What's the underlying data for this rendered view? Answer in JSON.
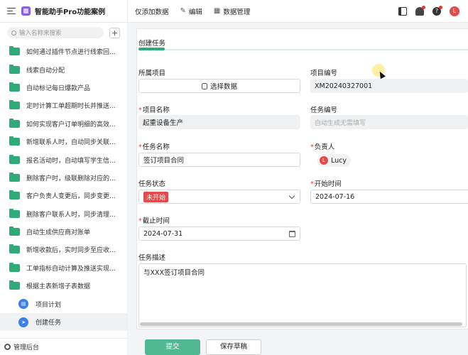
{
  "app": {
    "title": "智能助手Pro功能案例",
    "user_avatar": "L"
  },
  "toolbar": {
    "add_only": "仅添加数据",
    "edit": "编辑",
    "data_manage": "数据管理"
  },
  "sidebar": {
    "search_placeholder": "输入名称来搜索",
    "add_symbol": "+",
    "items": [
      {
        "label": "如何通过插件节点进行线索回..."
      },
      {
        "label": "线索自动分配"
      },
      {
        "label": "自动标记每日爆款产品"
      },
      {
        "label": "定时计算工单超期时长并推送..."
      },
      {
        "label": "如何实现客户订单明细的高效..."
      },
      {
        "label": "新增联系人时，自动同步关联..."
      },
      {
        "label": "报名活动时，自动填写学生信..."
      },
      {
        "label": "删除客户时，级联删除对应的..."
      },
      {
        "label": "客户负责人变更后，同步变更..."
      },
      {
        "label": "删除客户联系人时，同步清理..."
      },
      {
        "label": "自动生成供应商对账单"
      },
      {
        "label": "新增收款后，实时同步至应收..."
      },
      {
        "label": "工单指标自动计算及推送实现..."
      },
      {
        "label": "根据主表新增子表数据"
      }
    ],
    "sub_items": [
      {
        "label": "项目计划"
      },
      {
        "label": "创建任务"
      }
    ],
    "footer": "管理后台"
  },
  "form": {
    "tab_title": "创建任务",
    "project": {
      "label": "所属项目",
      "button": "选择数据"
    },
    "project_code": {
      "label": "项目编号",
      "value": "XM20240327001"
    },
    "project_name": {
      "label": "项目名称",
      "value": "起重设备生产"
    },
    "task_code": {
      "label": "任务编号",
      "placeholder": "自动生成无需填写"
    },
    "task_name": {
      "label": "任务名称",
      "value": "签订项目合同"
    },
    "owner": {
      "label": "负责人",
      "value": "Lucy",
      "avatar": "L"
    },
    "task_status": {
      "label": "任务状态",
      "value": "未开始"
    },
    "start_time": {
      "label": "开始时间",
      "value": "2024-07-16"
    },
    "deadline": {
      "label": "截止时间",
      "value": "2024-07-31"
    },
    "description": {
      "label": "任务描述",
      "value": "与XXX签订项目合同"
    },
    "required_mark": "*"
  },
  "actions": {
    "submit": "提交",
    "save_draft": "保存草稿"
  },
  "colors": {
    "accent": "#2fab78",
    "submit": "#52b893",
    "status_tag": "#e34a4a",
    "logo": "#8a5cf5",
    "sub_icon": "#3b7fe8"
  }
}
